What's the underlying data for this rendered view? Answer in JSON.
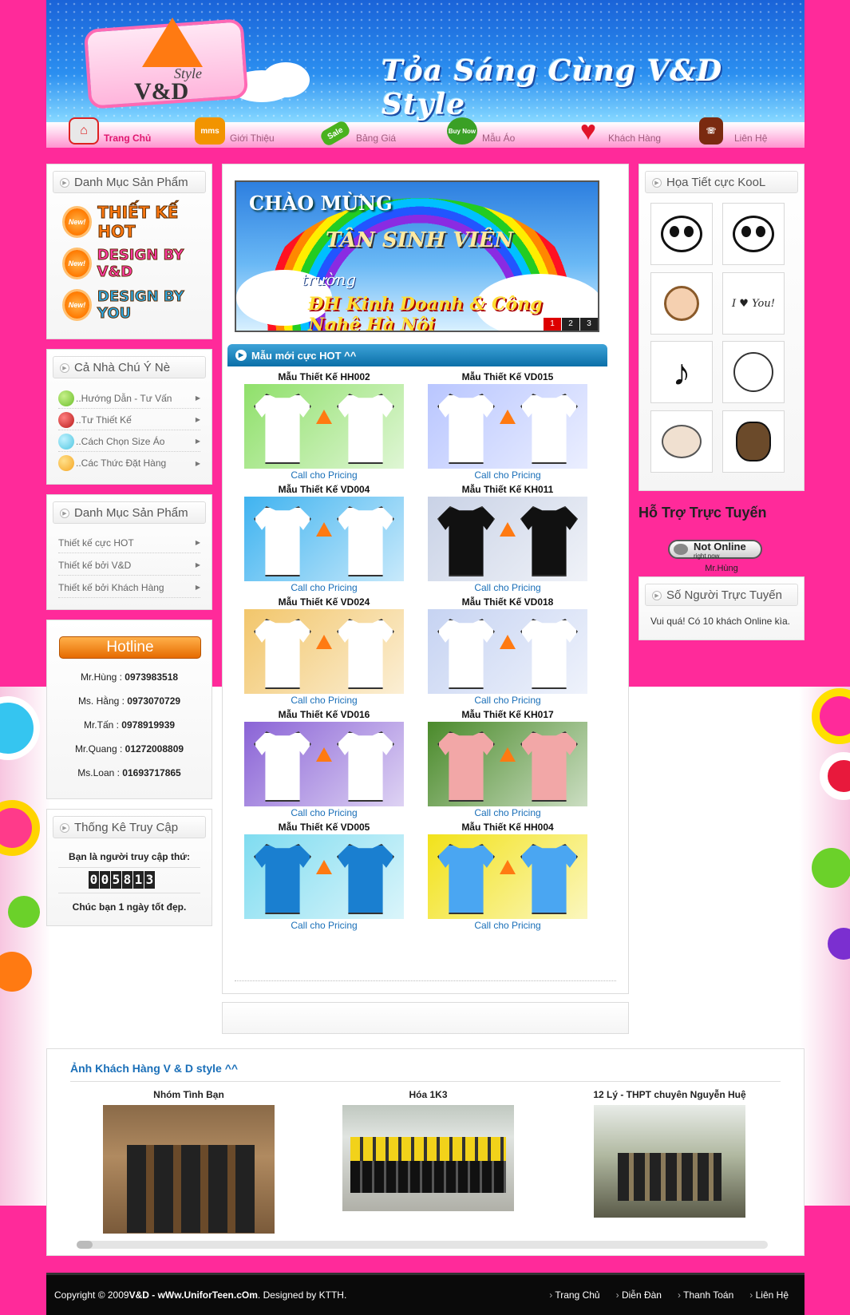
{
  "header": {
    "logo_brand": "V&D",
    "logo_style": "Style",
    "slogan": "Tỏa Sáng Cùng V&D Style",
    "nav": [
      {
        "label": "Trang Chủ",
        "icon": "home-icon",
        "badge": "",
        "color": "#e14",
        "active": true
      },
      {
        "label": "Giới Thiệu",
        "icon": "mms-icon",
        "badge": "mms",
        "color": "#f29400",
        "active": false
      },
      {
        "label": "Bảng Giá",
        "icon": "sale-tag-icon",
        "badge": "Sale",
        "color": "#49b21e",
        "active": false
      },
      {
        "label": "Mẫu Áo",
        "icon": "buy-now-icon",
        "badge": "Buy Now",
        "color": "#3aa025",
        "active": false
      },
      {
        "label": "Khách Hàng",
        "icon": "heart-icon",
        "badge": "",
        "color": "#e0142a",
        "active": false
      },
      {
        "label": "Liên Hệ",
        "icon": "address-book-icon",
        "badge": "",
        "color": "#7a2a10",
        "active": false
      }
    ]
  },
  "left": {
    "box1": {
      "title": "Danh Mục Sản Phẩm",
      "promos": [
        {
          "badge": "New!",
          "text": "THIẾT KẾ HOT",
          "color": "#ff7a12"
        },
        {
          "badge": "New!",
          "text": "DESIGN BY V&D",
          "color": "#ff3aa6"
        },
        {
          "badge": "New!",
          "text": "DESIGN BY YOU",
          "color": "#2da6e0"
        }
      ]
    },
    "box2": {
      "title": "Cả Nhà Chú Ý Nè",
      "items": [
        {
          "label": "..Hướng Dẫn - Tư Vấn",
          "ball": "#6bbf2a"
        },
        {
          "label": "..Tư Thiết Kế",
          "ball": "#b81a1a"
        },
        {
          "label": "..Cách Chọn Size Áo",
          "ball": "#4fc6e0"
        },
        {
          "label": "..Các Thức Đặt Hàng",
          "ball": "#f5a623"
        }
      ]
    },
    "box3": {
      "title": "Danh Mục Sản Phẩm",
      "items": [
        "Thiết kế cực HOT",
        "Thiết kế bởi V&D",
        "Thiết kế bởi Khách Hàng"
      ]
    },
    "hotline": {
      "button": "Hotline",
      "contacts": [
        {
          "name": "Mr.Hùng : ",
          "phone": "0973983518"
        },
        {
          "name": "Ms. Hằng : ",
          "phone": "0973070729"
        },
        {
          "name": "Mr.Tấn : ",
          "phone": "0978919939"
        },
        {
          "name": "Mr.Quang : ",
          "phone": "01272008809"
        },
        {
          "name": "Ms.Loan : ",
          "phone": "01693717865"
        }
      ]
    },
    "stats": {
      "title": "Thống Kê Truy Cập",
      "label": "Bạn là người truy cập thứ:",
      "counter": [
        "0",
        "0",
        "5",
        "8",
        "1",
        "3"
      ],
      "wish": "Chúc bạn 1 ngày tốt đẹp."
    }
  },
  "center": {
    "banner": {
      "line1": "CHÀO MỪNG",
      "line2": "TÂN SINH VIÊN",
      "line3": "trường",
      "line4": "ĐH Kinh Doanh & Công Nghệ Hà Nội",
      "pages": [
        "1",
        "2",
        "3"
      ]
    },
    "section_title": "Mẫu mới cực HOT ^^",
    "products": [
      {
        "title": "Mẫu Thiết Kế HH002",
        "link": "Call cho Pricing",
        "bg": "#8fe06a",
        "s1": "#ffffff",
        "s2": "#ffffff"
      },
      {
        "title": "Mẫu Thiết Kế VD015",
        "link": "Call cho Pricing",
        "bg": "#b9c6ff",
        "s1": "#ffffff",
        "s2": "#ffffff"
      },
      {
        "title": "Mẫu Thiết Kế VD004",
        "link": "Call cho Pricing",
        "bg": "#3fb3f0",
        "s1": "#ffffff",
        "s2": "#ffffff"
      },
      {
        "title": "Mẫu Thiết Kế KH011",
        "link": "Call cho Pricing",
        "bg": "#c9d2e6",
        "s1": "#111111",
        "s2": "#111111"
      },
      {
        "title": "Mẫu Thiết Kế VD024",
        "link": "Call cho Pricing",
        "bg": "#f2c66b",
        "s1": "#ffffff",
        "s2": "#ffffff"
      },
      {
        "title": "Mẫu Thiết Kế VD018",
        "link": "Call cho Pricing",
        "bg": "#c6d3f2",
        "s1": "#ffffff",
        "s2": "#ffffff"
      },
      {
        "title": "Mẫu Thiết Kế VD016",
        "link": "Call cho Pricing",
        "bg": "#8a63d6",
        "s1": "#ffffff",
        "s2": "#ffffff"
      },
      {
        "title": "Mẫu Thiết Kế KH017",
        "link": "Call cho Pricing",
        "bg": "#4a8a2a",
        "s1": "#f2a7a7",
        "s2": "#f2a7a7"
      },
      {
        "title": "Mẫu Thiết Kế VD005",
        "link": "Call cho Pricing",
        "bg": "#7fdcf0",
        "s1": "#1a7fd0",
        "s2": "#1a7fd0"
      },
      {
        "title": "Mẫu Thiết Kế HH004",
        "link": "Call cho Pricing",
        "bg": "#f2e21a",
        "s1": "#4aa6f2",
        "s2": "#4aa6f2"
      }
    ]
  },
  "right": {
    "icons_title": "Họa Tiết cực KooL",
    "support_title": "Hỗ Trợ Trực Tuyến",
    "status_main": "Not Online",
    "status_sub": "right now",
    "support_name": "Mr.Hùng",
    "online_title": "Số Người Trực Tuyến",
    "online_text": "Vui quá! Có 10 khách Online kìa."
  },
  "customers": {
    "title": "Ảnh Khách Hàng V & D style ^^",
    "items": [
      "Nhóm Tình Bạn",
      "Hóa 1K3",
      "12 Lý - THPT chuyên Nguyễn Huệ"
    ]
  },
  "footer": {
    "copyright_pre": "Copyright © 2009 ",
    "copyright_brand": "V&D - wWw.UniforTeen.cOm",
    "copyright_post": ". Designed by KTTH.",
    "links": [
      "Trang Chủ",
      "Diễn Đàn",
      "Thanh Toán",
      "Liên Hệ"
    ]
  }
}
